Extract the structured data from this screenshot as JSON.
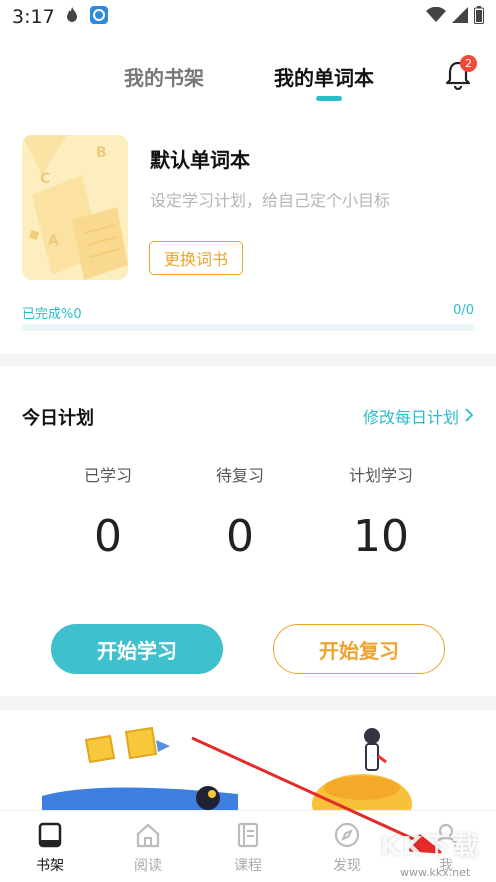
{
  "status": {
    "time": "3:17"
  },
  "header": {
    "tabs": [
      {
        "label": "我的书架",
        "active": false
      },
      {
        "label": "我的单词本",
        "active": true
      }
    ],
    "notification_count": "2"
  },
  "book": {
    "title": "默认单词本",
    "description": "设定学习计划，给自己定个小目标",
    "change_button": "更换词书",
    "progress_label": "已完成%0",
    "progress_count": "0/0",
    "progress_fraction": 0
  },
  "plan": {
    "title": "今日计划",
    "modify_link": "修改每日计划",
    "stats": [
      {
        "label": "已学习",
        "value": "0"
      },
      {
        "label": "待复习",
        "value": "0"
      },
      {
        "label": "计划学习",
        "value": "10"
      }
    ],
    "start_button": "开始学习",
    "review_button": "开始复习"
  },
  "nav": {
    "items": [
      {
        "label": "书架",
        "icon": "bookshelf-icon",
        "active": true
      },
      {
        "label": "阅读",
        "icon": "home-icon",
        "active": false
      },
      {
        "label": "课程",
        "icon": "course-icon",
        "active": false
      },
      {
        "label": "发现",
        "icon": "compass-icon",
        "active": false
      },
      {
        "label": "我",
        "icon": "user-icon",
        "active": false
      }
    ]
  },
  "colors": {
    "accent": "#2bbccc",
    "orange": "#f0a32c",
    "badge": "#f04a3a"
  },
  "watermark": {
    "text": "KK下载",
    "url": "www.kkx.net"
  }
}
